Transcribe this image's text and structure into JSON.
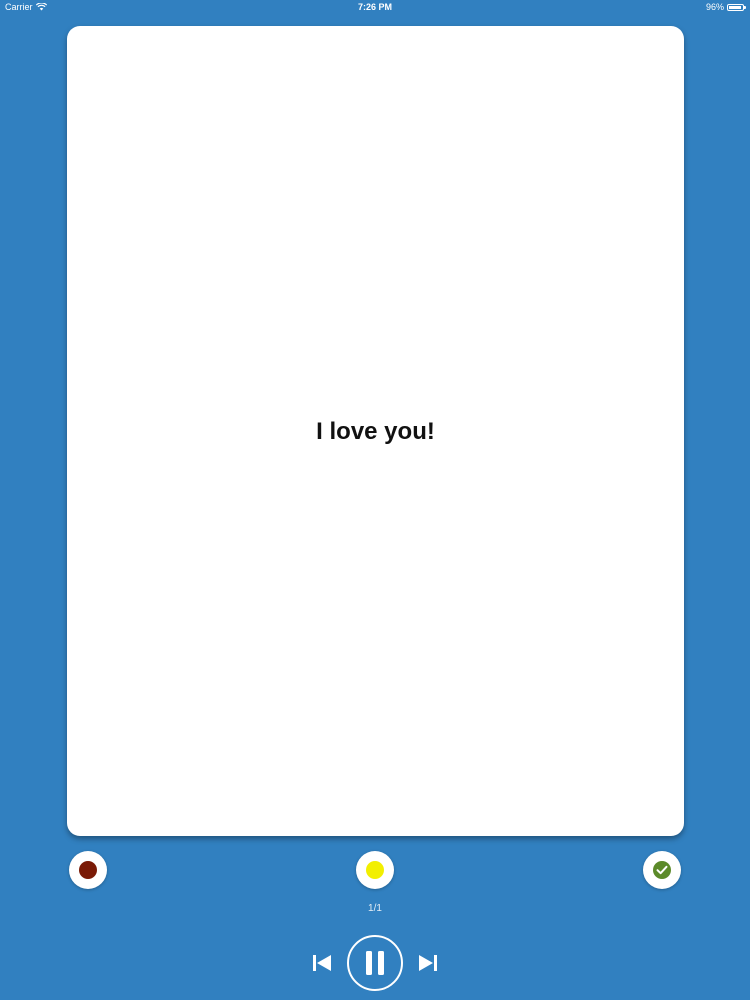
{
  "status_bar": {
    "carrier": "Carrier",
    "time": "7:26 PM",
    "battery": "96%",
    "battery_level": 0.96,
    "wifi_icon": "wifi-icon"
  },
  "card": {
    "text": "I love you!"
  },
  "rating_buttons": [
    {
      "name": "red-dot",
      "color": "#7a1a06"
    },
    {
      "name": "yellow-dot",
      "color": "#f2ef00"
    },
    {
      "name": "check-mark-icon",
      "color": "#5c8a2a"
    }
  ],
  "page_counter": "1/1",
  "player": {
    "prev_icon": "skip-previous-icon",
    "pause_icon": "pause-icon",
    "next_icon": "skip-next-icon"
  },
  "colors": {
    "background": "#3180c0",
    "card": "#ffffff"
  }
}
